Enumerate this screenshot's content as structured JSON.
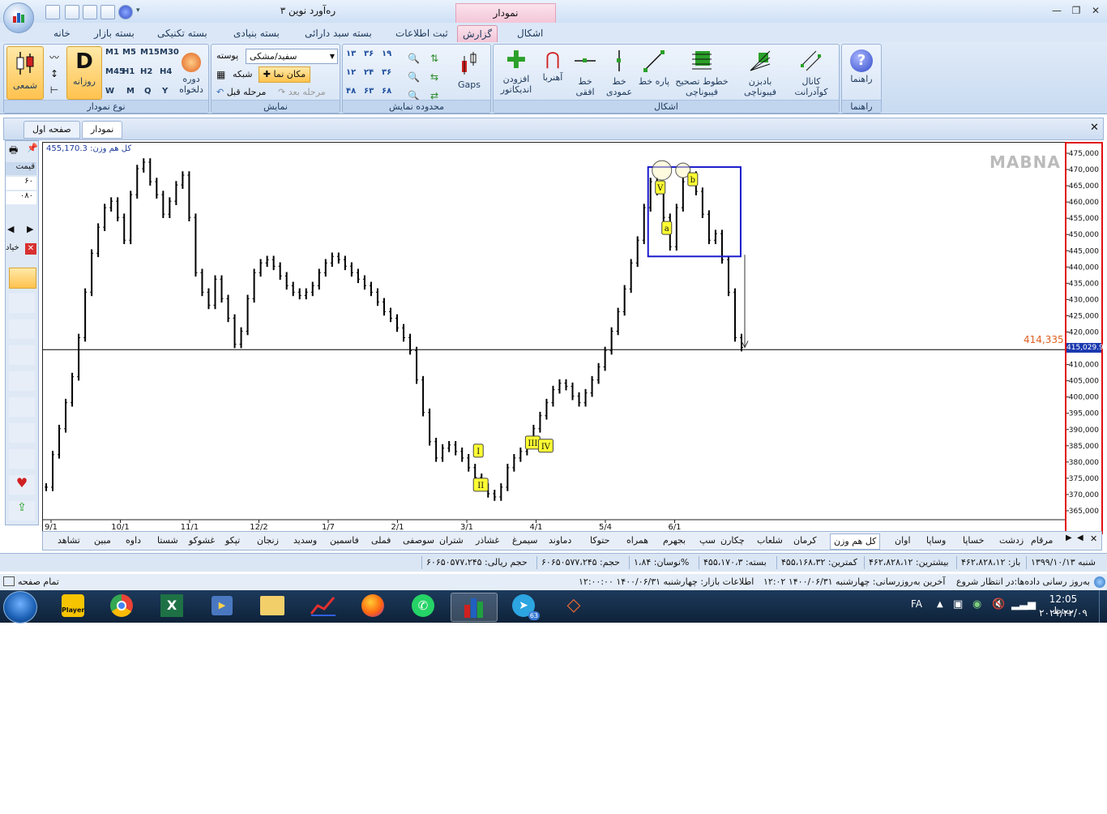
{
  "window": {
    "title": "ره‌آورد نوین ۳",
    "context_tab": "نمودار"
  },
  "ribbon_tabs": [
    "خانه",
    "بسته بازار",
    "بسته تکنیکی",
    "بسته بنیادی",
    "بسته سبد دارائی",
    "ثبت اطلاعات",
    "گزارش",
    "اشکال"
  ],
  "ribbon_active_tab": "گزارش",
  "groups": {
    "chart_type": {
      "caption": "نوع نمودار",
      "candle_label": "شمعی",
      "daily_label": "روزانه",
      "custom_period_label": "دوره دلخواه",
      "timeframes": [
        "M1",
        "M5",
        "M15",
        "M30",
        "M45",
        "H1",
        "H2",
        "H4",
        "W",
        "M",
        "Q",
        "Y"
      ]
    },
    "display": {
      "caption": "نمایش",
      "skin_value": "سفید/مشکی",
      "skin_label": "پوسته",
      "grid_label": "شبکه",
      "crosshair_label": "مکان نما",
      "prev_step": "مرحله قبل",
      "next_step": "مرحله بعد"
    },
    "range": {
      "caption": "محدوده نمایش",
      "gaps_label": "Gaps",
      "labels": [
        "۱۳",
        "۳۶",
        "۱۹",
        "۱۲",
        "۲۴",
        "۳۶",
        "۴۸",
        "۶۳",
        "۶۸"
      ]
    },
    "shapes": {
      "caption": "اشکال",
      "items": [
        "افزودن اندیکاتور",
        "آهنربا",
        "خط افقی",
        "خط عمودی",
        "پاره خط",
        "خطوط تصحیح فیبوناچی",
        "بادبزن فیبوناچی",
        "کانال کوآدرانت"
      ]
    },
    "help": {
      "caption": "راهنما",
      "label": "راهنما"
    }
  },
  "doc_tabs": [
    "صفحه اول",
    "نمودار"
  ],
  "chart": {
    "info": "کل هم وزن: 455,170.3",
    "watermark": "MABNA",
    "price_line_label": "414,335",
    "last_price": "415,029.9",
    "wave_labels": [
      "I",
      "II",
      "III",
      "IV",
      "V",
      "a",
      "b"
    ],
    "left_panel": {
      "header": "قیمت",
      "values": [
        "۶۰",
        "۰۸۰"
      ],
      "search": "خیاد"
    }
  },
  "chart_data": {
    "type": "line",
    "title": "",
    "y_ticks": [
      475000,
      470000,
      465000,
      460000,
      455000,
      450000,
      445000,
      440000,
      435000,
      430000,
      425000,
      420000,
      415000,
      410000,
      405000,
      400000,
      395000,
      390000,
      385000,
      380000,
      375000,
      370000,
      365000
    ],
    "ylim": [
      362000,
      478000
    ],
    "x_ticks": [
      "9/1",
      "10/1",
      "11/1",
      "12/2",
      "1/7",
      "2/1",
      "3/1",
      "4/1",
      "5/4",
      "6/1"
    ],
    "series": [
      {
        "values": [
          372000,
          382000,
          390000,
          398000,
          406000,
          418000,
          432000,
          444000,
          452000,
          458000,
          460000,
          455000,
          448000,
          462000,
          470000,
          472000,
          466000,
          462000,
          456000,
          460000,
          465000,
          468000,
          455000,
          438000,
          432000,
          428000,
          436000,
          430000,
          424000,
          416000,
          420000,
          430000,
          438000,
          441000,
          442000,
          440000,
          437000,
          434000,
          432000,
          431000,
          432000,
          434000,
          438000,
          441000,
          443000,
          442000,
          440000,
          438000,
          436000,
          434000,
          432000,
          429000,
          426000,
          424000,
          421000,
          418000,
          414000,
          405000,
          395000,
          386000,
          381000,
          384000,
          385000,
          383000,
          381000,
          378000,
          375000,
          372000,
          370000,
          369000,
          372000,
          378000,
          381000,
          383000,
          385000,
          390000,
          394000,
          398000,
          402000,
          404000,
          403000,
          400000,
          398000,
          401000,
          405000,
          409000,
          414000,
          420000,
          426000,
          433000,
          441000,
          448000,
          458000,
          466000,
          463000,
          455000,
          446000,
          458000,
          466000,
          468000,
          463000,
          456000,
          448000,
          450000,
          442000,
          432000,
          418000,
          415000
        ]
      }
    ],
    "price_line": 414335,
    "last": 415029.9
  },
  "symbols": [
    "مرقام",
    "زدشت",
    "خساپا",
    "وساپا",
    "اوان",
    "کل هم وزن",
    "کرمان",
    "شلعاب",
    "چکارن",
    "سپ",
    "بجهرم",
    "همراه",
    "حتوکا",
    "دماوند",
    "سیمرغ",
    "غشاذر",
    "شتران",
    "سوصفی",
    "فملی",
    "فاسمین",
    "وسدید",
    "زنجان",
    "تپکو",
    "غشوکو",
    "شستا",
    "داوه",
    "مبین",
    "تشاهد"
  ],
  "active_symbol": "کل هم وزن",
  "status": [
    "شنبه ۱۳۹۹/۱۰/۱۳",
    "باز: ۴۶۲،۸۲۸،۱۲",
    "بیشترین: ۴۶۲،۸۲۸،۱۲",
    "کمترین: ۴۵۵،۱۶۸،۳۲",
    "بسته: ۴۵۵،۱۷۰،۳",
    "نوسان: ۱،۸۴%",
    "حجم: ۶۰۶۵۰۵۷۷،۲۴۵",
    "حجم ریالی: ۶۰۶۵۰۵۷۷،۲۴۵"
  ],
  "info_bar": {
    "update": "به‌روز رسانی داده‌ها:در انتظار شروع",
    "last_update": "آخرین به‌روزرسانی: چهارشنبه ۱۴۰۰/۰۶/۳۱ ۱۲:۰۲",
    "market": "اطلاعات بازار: چهارشنبه ۱۴۰۰/۰۶/۳۱ ۱۲:۰۰:۰۰",
    "fullpage": "تمام صفحه"
  },
  "taskbar": {
    "lang": "FA",
    "time": "12:05 ب.ظ",
    "date": "۲۰۲۱/۲۲/۰۹",
    "telegram_badge": "63",
    "player_label": "Player"
  },
  "colors": {
    "price_border": "#e01010",
    "annotation_box": "#1a1acc",
    "wave_label_bg": "#ffff33",
    "active_tab": "#f3c4d6"
  }
}
